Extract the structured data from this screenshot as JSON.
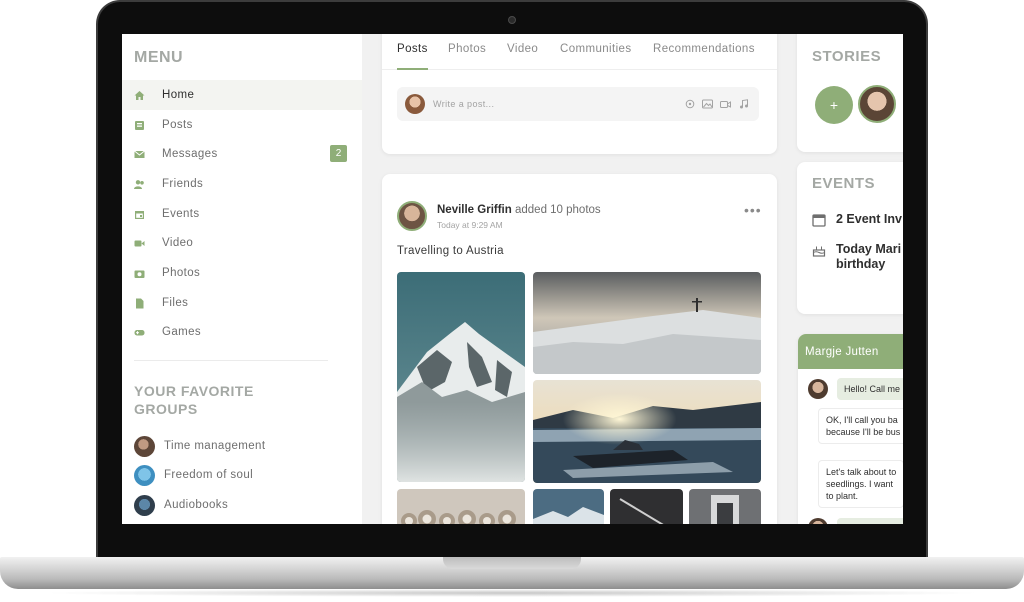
{
  "menu": {
    "title": "MENU",
    "items": [
      {
        "label": "Home",
        "icon": "home-icon",
        "active": true
      },
      {
        "label": "Posts",
        "icon": "posts-icon"
      },
      {
        "label": "Messages",
        "icon": "mail-icon",
        "badge": "2"
      },
      {
        "label": "Friends",
        "icon": "friends-icon"
      },
      {
        "label": "Events",
        "icon": "calendar-icon"
      },
      {
        "label": "Video",
        "icon": "video-icon"
      },
      {
        "label": "Photos",
        "icon": "camera-icon"
      },
      {
        "label": "Files",
        "icon": "file-icon"
      },
      {
        "label": "Games",
        "icon": "gamepad-icon"
      }
    ],
    "groups_title": "YOUR FAVORITE GROUPS",
    "groups": [
      {
        "label": "Time management",
        "icon": "group-avatar"
      },
      {
        "label": "Freedom of soul",
        "icon": "group-avatar"
      },
      {
        "label": "Audiobooks",
        "icon": "group-avatar"
      }
    ]
  },
  "feed": {
    "tabs": [
      "Posts",
      "Photos",
      "Video",
      "Communities",
      "Recommendations"
    ],
    "active_tab": "Posts",
    "composer": {
      "placeholder": "Write a post..."
    },
    "post": {
      "author": "Neville Griffin",
      "action": "added 10 photos",
      "time": "Today at 9:29 AM",
      "text": "Travelling to Austria"
    }
  },
  "stories": {
    "title": "STORIES",
    "add_label": "+"
  },
  "events": {
    "title": "EVENTS",
    "items": [
      {
        "text": "2 Event Inv",
        "icon": "calendar-icon"
      },
      {
        "text": "Today Mari",
        "text2": "birthday",
        "icon": "cake-icon"
      }
    ]
  },
  "chat": {
    "contact": "Margje Jutten",
    "messages": [
      {
        "from": "them",
        "lines": [
          "Hello! Call me"
        ]
      },
      {
        "from": "me",
        "lines": [
          "OK, I'll call you ba",
          "because I'll be bus"
        ]
      },
      {
        "from": "me",
        "lines": [
          "Let's talk about to",
          "seedlings. I want",
          "to plant."
        ]
      }
    ]
  },
  "colors": {
    "accent": "#8fae78",
    "muted_heading": "#a4a8a4",
    "text": "#2f2f2f"
  }
}
